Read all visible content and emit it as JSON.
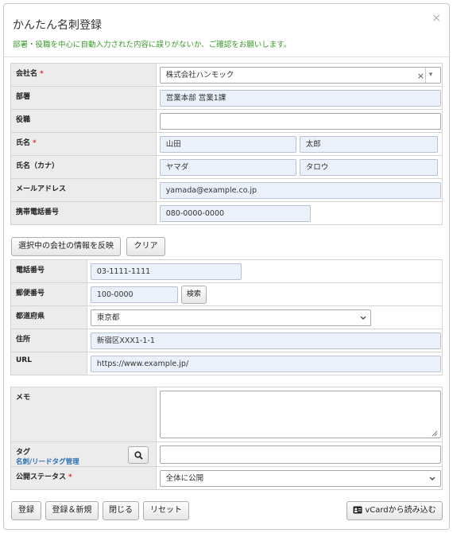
{
  "dialog": {
    "title": "かんたん名刺登録",
    "close_glyph": "×",
    "subtitle": "部署・役職を中心に自動入力された内容に誤りがないか、ご確認をお願いします。"
  },
  "contact": {
    "company_label": "会社名",
    "company_value": "株式会社ハンモック",
    "company_clear": "×",
    "company_arrow": "▾",
    "dept_label": "部署",
    "dept_value": "営業本部 営業1課",
    "title_label": "役職",
    "title_value": "",
    "name_label": "氏名",
    "last_name": "山田",
    "first_name": "太郎",
    "kana_label": "氏名（カナ）",
    "last_kana": "ヤマダ",
    "first_kana": "タロウ",
    "email_label": "メールアドレス",
    "email_value": "yamada@example.co.jp",
    "mobile_label": "携帯電話番号",
    "mobile_value": "080-0000-0000",
    "required_mark": "*"
  },
  "company_actions": {
    "reflect_label": "選択中の会社の情報を反映",
    "clear_label": "クリア"
  },
  "company_info": {
    "phone_label": "電話番号",
    "phone_value": "03-1111-1111",
    "zip_label": "郵便番号",
    "zip_value": "100-0000",
    "search_label": "検索",
    "pref_label": "都道府県",
    "pref_value": "東京都",
    "address_label": "住所",
    "address_value": "新宿区XXX1-1-1",
    "url_label": "URL",
    "url_value": "https://www.example.jp/"
  },
  "extra": {
    "memo_label": "メモ",
    "memo_value": "",
    "tag_label": "タグ",
    "tag_link": "名刺/リードタグ管理",
    "tag_value": "",
    "status_label": "公開ステータス",
    "status_value": "全体に公開",
    "required_mark": "*"
  },
  "footer": {
    "register_label": "登録",
    "register_new_label": "登録＆新規",
    "close_label": "閉じる",
    "reset_label": "リセット",
    "vcard_label": "vCardから読み込む"
  }
}
